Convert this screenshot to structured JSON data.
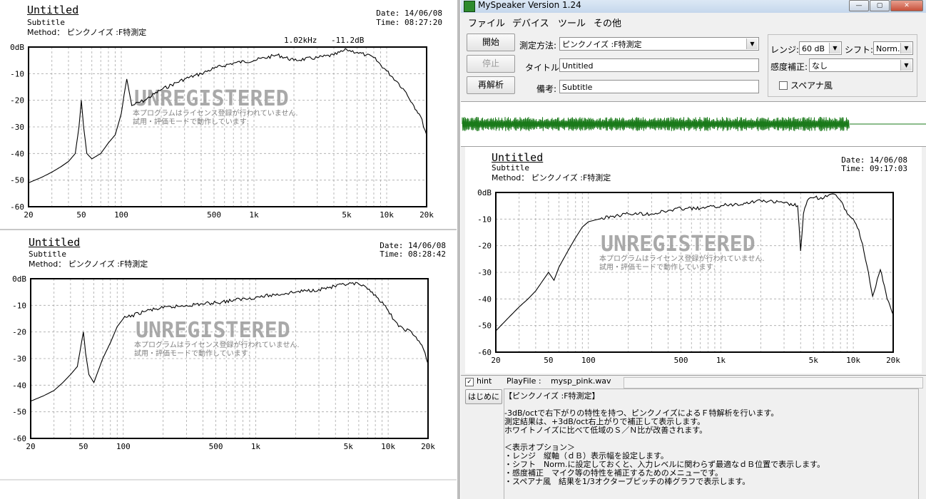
{
  "reports": [
    {
      "title": "Untitled",
      "subtitle": "Subtitle",
      "method": "Method： ピンクノイズ  :F特測定",
      "date": "Date: 14/06/08",
      "time": "Time: 08:27:20",
      "cursor_freq": "1.02kHz",
      "cursor_level": "-11.2dB",
      "watermark": "UNREGISTERED",
      "watermark_sub1": "本プログラムはライセンス登録が行われていません.",
      "watermark_sub2": "試用・評価モードで動作しています."
    },
    {
      "title": "Untitled",
      "subtitle": "Subtitle",
      "method": "Method： ピンクノイズ  :F特測定",
      "date": "Date: 14/06/08",
      "time": "Time: 08:28:42",
      "watermark": "UNREGISTERED",
      "watermark_sub1": "本プログラムはライセンス登録が行われていません.",
      "watermark_sub2": "試用・評価モードで動作しています."
    },
    {
      "title": "Untitled",
      "subtitle": "Subtitle",
      "method": "Method： ピンクノイズ  :F特測定",
      "date": "Date: 14/06/08",
      "time": "Time: 09:17:03",
      "watermark": "UNREGISTERED",
      "watermark_sub1": "本プログラムはライセンス登録が行われていません.",
      "watermark_sub2": "試用・評価モードで動作しています."
    }
  ],
  "chart_data": [
    {
      "type": "line",
      "x_scale": "log",
      "xlim": [
        20,
        20000
      ],
      "ylim": [
        -60,
        0
      ],
      "x_ticks": [
        "20",
        "50",
        "100",
        "500",
        "1k",
        "5k",
        "10k",
        "20k"
      ],
      "y_ticks": [
        "0dB",
        "-10",
        "-20",
        "-30",
        "-40",
        "-50",
        "-60"
      ],
      "grid": true,
      "x": [
        20,
        25,
        30,
        35,
        40,
        45,
        48,
        50,
        52,
        55,
        60,
        70,
        80,
        90,
        100,
        105,
        110,
        120,
        150,
        200,
        300,
        400,
        500,
        700,
        1000,
        1500,
        2000,
        3000,
        4000,
        5000,
        6000,
        7000,
        8000,
        10000,
        12000,
        14000,
        16000,
        18000,
        20000
      ],
      "y": [
        -51,
        -49,
        -47,
        -45,
        -43,
        -40,
        -30,
        -20,
        -30,
        -40,
        -42,
        -40,
        -36,
        -33,
        -25,
        -18,
        -12,
        -22,
        -20,
        -16,
        -12,
        -10,
        -8,
        -6,
        -5,
        -3,
        -5,
        -4,
        -3,
        -1,
        -2,
        -3,
        -4,
        -9,
        -13,
        -17,
        -22,
        -26,
        -33
      ]
    },
    {
      "type": "line",
      "x_scale": "log",
      "xlim": [
        20,
        20000
      ],
      "ylim": [
        -60,
        0
      ],
      "x_ticks": [
        "20",
        "50",
        "100",
        "500",
        "1k",
        "5k",
        "10k",
        "20k"
      ],
      "y_ticks": [
        "0dB",
        "-10",
        "-20",
        "-30",
        "-40",
        "-50",
        "-60"
      ],
      "grid": true,
      "x": [
        20,
        25,
        30,
        35,
        40,
        45,
        48,
        50,
        52,
        55,
        60,
        70,
        80,
        90,
        100,
        150,
        200,
        300,
        500,
        700,
        1000,
        2000,
        3000,
        5000,
        6000,
        7000,
        8000,
        10000,
        12000,
        15000,
        18000,
        20000
      ],
      "y": [
        -46,
        -44,
        -42,
        -39,
        -36,
        -33,
        -25,
        -20,
        -28,
        -36,
        -39,
        -30,
        -24,
        -18,
        -15,
        -12,
        -11,
        -10,
        -9,
        -8,
        -7,
        -5,
        -4,
        -2,
        -2,
        -4,
        -6,
        -12,
        -18,
        -20,
        -25,
        -32
      ]
    },
    {
      "type": "line",
      "x_scale": "log",
      "xlim": [
        20,
        20000
      ],
      "ylim": [
        -60,
        0
      ],
      "x_ticks": [
        "20",
        "50",
        "100",
        "500",
        "1k",
        "5k",
        "10k",
        "20k"
      ],
      "y_ticks": [
        "0dB",
        "-10",
        "-20",
        "-30",
        "-40",
        "-50",
        "-60"
      ],
      "grid": true,
      "x": [
        20,
        25,
        30,
        35,
        40,
        50,
        55,
        60,
        70,
        80,
        90,
        100,
        120,
        150,
        200,
        300,
        500,
        700,
        1000,
        1500,
        2000,
        3000,
        3800,
        4000,
        4200,
        4500,
        5000,
        6000,
        6500,
        7000,
        8000,
        9000,
        10000,
        11000,
        12000,
        13000,
        14000,
        16000,
        18000,
        20000
      ],
      "y": [
        -52,
        -47,
        -43,
        -40,
        -37,
        -30,
        -33,
        -28,
        -22,
        -17,
        -13,
        -11,
        -10,
        -9,
        -8,
        -8,
        -6,
        -6,
        -5,
        -4,
        -3,
        -4,
        -5,
        -22,
        -8,
        -3,
        -2,
        -2,
        -1,
        -0.5,
        -3,
        -8,
        -10,
        -14,
        -22,
        -30,
        -39,
        -29,
        -40,
        -46
      ]
    }
  ],
  "app": {
    "title": "MySpeaker Version 1.24",
    "win_min": "—",
    "win_max": "▢",
    "win_close": "✕",
    "menu": [
      "ファイル",
      "デバイス",
      "ツール",
      "その他"
    ],
    "buttons": {
      "start": "開始",
      "stop": "停止",
      "reanalyze": "再解析"
    },
    "method_label": "測定方法:",
    "method_value": "ピンクノイズ  :F特測定",
    "title_label": "タイトル:",
    "title_value": "Untitled",
    "note_label": "備考:",
    "note_value": "Subtitle",
    "range_label": "レンジ:",
    "range_value": "60 dB",
    "shift_label": "シフト:",
    "shift_value": "Norm.",
    "sens_label": "感度補正:",
    "sens_value": "なし",
    "spana_label": "スペアナ風",
    "waveform_color": "#1a7a1a",
    "hint_label": "hint",
    "playfile_label": "PlayFile :",
    "playfile_value": "mysp_pink.wav",
    "intro_button": "はじめに",
    "hint_lines": [
      "【ピンクノイズ  :F特測定】",
      "",
      "-3dB/octで右下がりの特性を持つ、ピンクノイズによるＦ特解析を行います。",
      "測定結果は、+3dB/oct右上がりで補正して表示します。",
      "ホワイトノイズに比べて低域のＳ／Ｎ比が改善されます。",
      "",
      "＜表示オプション＞",
      "・レンジ　縦軸（ｄＢ）表示幅を設定します。",
      "・シフト　Norm.に設定しておくと、入力レベルに関わらず最適なｄＢ位置で表示します。",
      "・感度補正　マイク等の特性を補正するためのメニューです。",
      "・スペアナ風　結果を1/3オクターブピッチの棒グラフで表示します。"
    ]
  }
}
